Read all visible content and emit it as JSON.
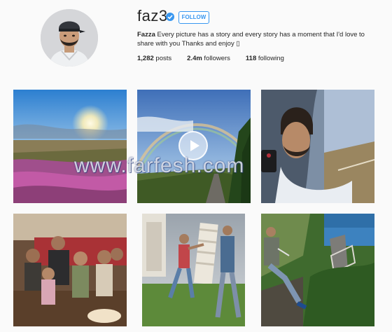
{
  "profile": {
    "username": "faz3",
    "follow_label": "FOLLOW",
    "bio_name": "Fazza",
    "bio_text": " Every picture has a story and every story has a moment that I'd love to share with you Thanks and enjoy ▯",
    "stats": {
      "posts_count": "1,282",
      "posts_label": " posts",
      "followers_count": "2.4m",
      "followers_label": " followers",
      "following_count": "118",
      "following_label": " following"
    }
  },
  "watermark": "www.farfesh.com",
  "colors": {
    "accent": "#3897f0",
    "background": "#fafafa"
  },
  "icons": {
    "verified": "verified-badge-icon",
    "play": "play-icon"
  }
}
